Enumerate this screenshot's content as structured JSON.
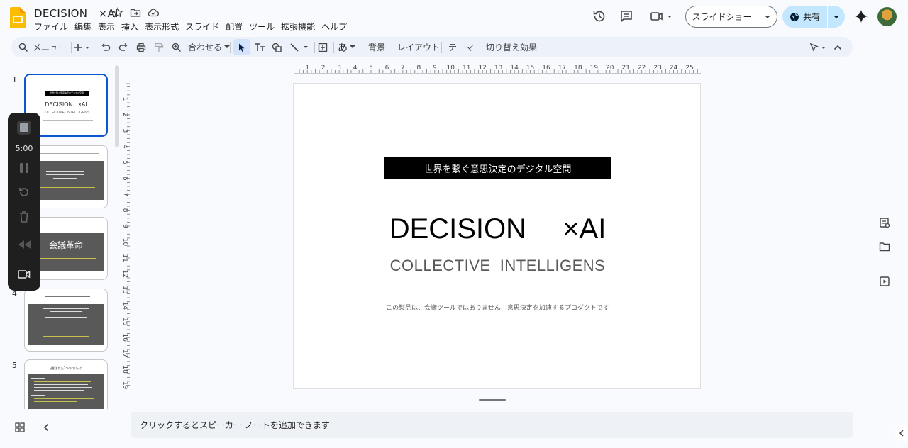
{
  "app": {
    "title": "DECISION　×AI"
  },
  "menu": [
    "ファイル",
    "編集",
    "表示",
    "挿入",
    "表示形式",
    "スライド",
    "配置",
    "ツール",
    "拡張機能",
    "ヘルプ"
  ],
  "header": {
    "slideshow_label": "スライドショー",
    "share_label": "共有"
  },
  "toolbar": {
    "menu_search": "メニュー",
    "zoom_label": "合わせる",
    "background": "背景",
    "layout": "レイアウト",
    "theme": "テーマ",
    "transition": "切り替え効果"
  },
  "timer": {
    "time": "5:00"
  },
  "filmstrip": {
    "numbers": [
      "1",
      "4",
      "5"
    ],
    "thumbs": [
      {
        "banner": "世界を繋ぐ意思決定のデジタル空間",
        "title": "DECISION　×AI",
        "sub": "COLLECTIVE  INTELLIGENS"
      },
      {
        "heading": "会議革命"
      },
      {
        "heading": "仕組まれた3つのロジック"
      }
    ]
  },
  "slide": {
    "banner": "世界を繋ぐ意思決定のデジタル空間",
    "title": "DECISION　 ×AI",
    "subtitle": "COLLECTIVE  INTELLIGENS",
    "caption": "この製品は、会議ツールではありません　意思決定を加速するプロダクトです"
  },
  "ruler": {
    "h_labels": [
      "1",
      "1",
      "2",
      "3",
      "4",
      "5",
      "6",
      "7",
      "8",
      "9",
      "10",
      "11",
      "12",
      "13",
      "14",
      "15",
      "16",
      "17",
      "18",
      "19",
      "20",
      "21",
      "22",
      "23",
      "24",
      "25"
    ],
    "v_labels": [
      "1",
      "1",
      "2",
      "3",
      "4",
      "5",
      "6",
      "7",
      "8",
      "9",
      "10",
      "11",
      "12",
      "13",
      "14",
      "15",
      "16",
      "17",
      "18",
      "19"
    ]
  },
  "notes": {
    "placeholder": "クリックするとスピーカー ノートを追加できます"
  },
  "colors": {
    "accent": "#0b57d0",
    "share_bg": "#c2e7ff",
    "toolbar_bg": "#edf2fa",
    "logo": "#fbbc04"
  },
  "icons": [
    "slides-logo-icon",
    "star-icon",
    "move-folder-icon",
    "cloud-icon",
    "history-icon",
    "comment-icon",
    "meet-icon",
    "gemini-icon",
    "search-icon",
    "undo-icon",
    "redo-icon",
    "print-icon",
    "paint-format-icon",
    "zoom-icon",
    "cursor-icon",
    "textbox-icon",
    "shape-icon",
    "line-icon",
    "comment-add-icon",
    "input-tools-icon",
    "pen-icon",
    "collapse-icon",
    "grid-view-icon",
    "collapse-panel-icon",
    "keep-icon",
    "folder-icon",
    "slides-panel-icon",
    "chevron-left-icon"
  ]
}
